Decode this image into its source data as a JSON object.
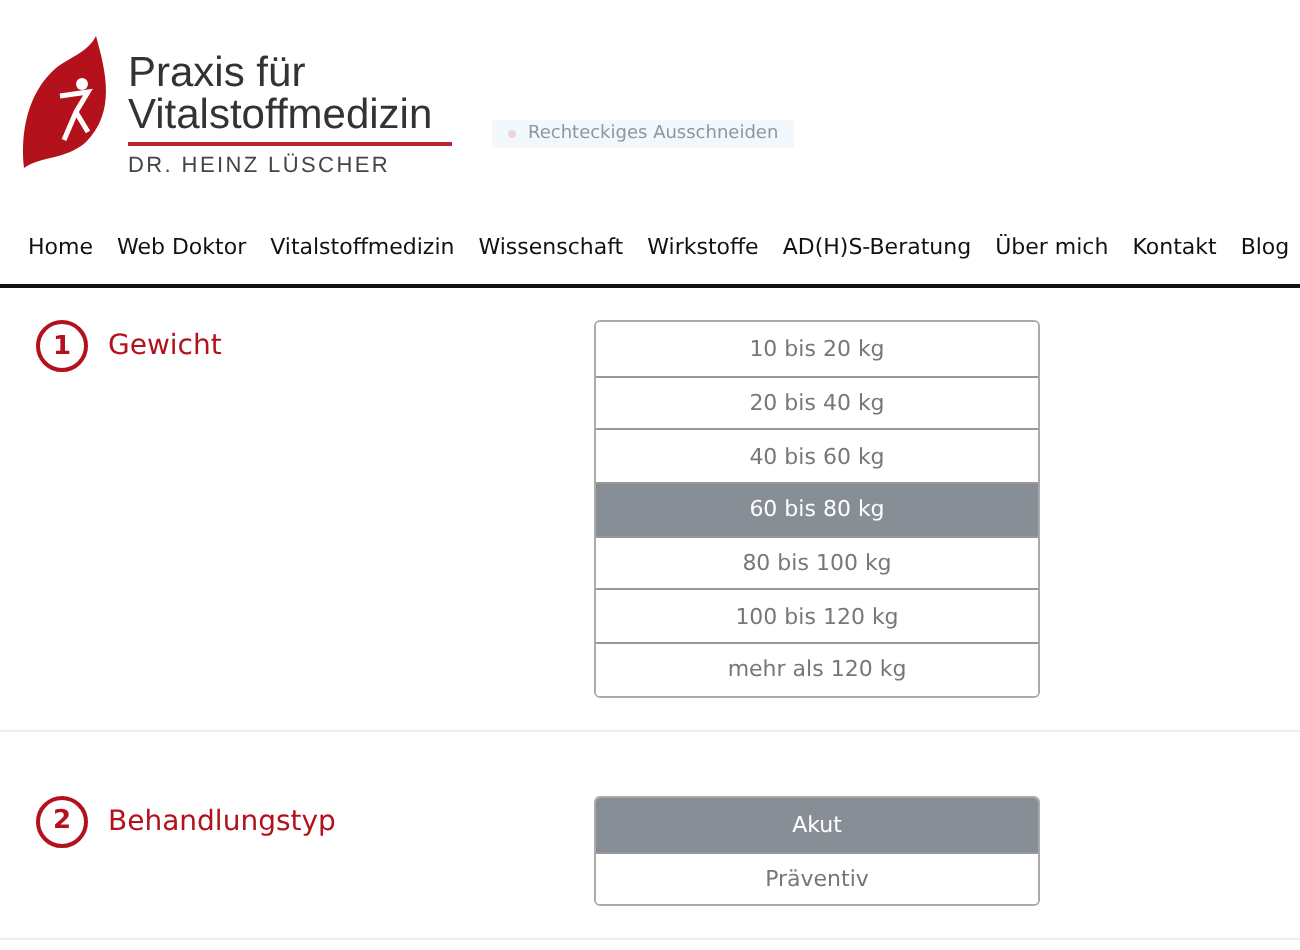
{
  "logo": {
    "line_1": "Praxis für",
    "line_2": "Vitalstoffmedizin",
    "subtitle": "DR. HEINZ LÜSCHER"
  },
  "overlay_hint": "Rechteckiges Ausschneiden",
  "nav": [
    "Home",
    "Web Doktor",
    "Vitalstoffmedizin",
    "Wissenschaft",
    "Wirkstoffe",
    "AD(H)S-Beratung",
    "Über mich",
    "Kontakt",
    "Blog"
  ],
  "questions": [
    {
      "number": "1",
      "label": "Gewicht",
      "options": [
        {
          "label": "10 bis 20 kg",
          "selected": false
        },
        {
          "label": "20 bis 40 kg",
          "selected": false
        },
        {
          "label": "40 bis 60 kg",
          "selected": false
        },
        {
          "label": "60 bis 80 kg",
          "selected": true
        },
        {
          "label": "80 bis 100 kg",
          "selected": false
        },
        {
          "label": "100 bis 120 kg",
          "selected": false
        },
        {
          "label": "mehr als 120 kg",
          "selected": false
        }
      ]
    },
    {
      "number": "2",
      "label": "Behandlungstyp",
      "options": [
        {
          "label": "Akut",
          "selected": true
        },
        {
          "label": "Präventiv",
          "selected": false
        }
      ]
    }
  ]
}
